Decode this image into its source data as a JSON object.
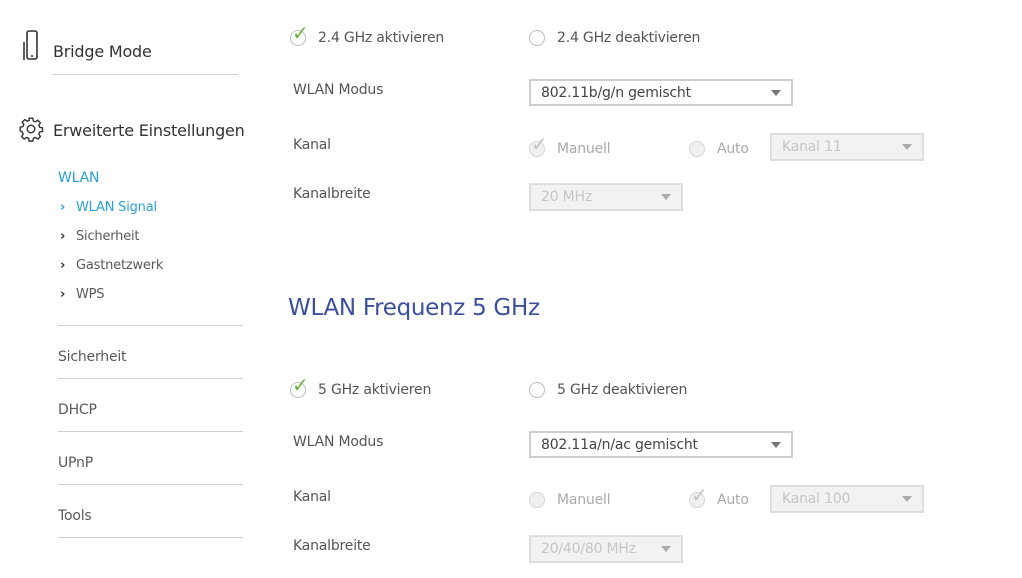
{
  "sidebar": {
    "bridge_mode": "Bridge Mode",
    "advanced": "Erweiterte Einstellungen",
    "wlan_heading": "WLAN",
    "wlan_items": [
      {
        "label": "WLAN Signal"
      },
      {
        "label": "Sicherheit"
      },
      {
        "label": "Gastnetzwerk"
      },
      {
        "label": "WPS"
      }
    ],
    "sections": [
      {
        "label": "Sicherheit"
      },
      {
        "label": "DHCP"
      },
      {
        "label": "UPnP"
      },
      {
        "label": "Tools"
      }
    ]
  },
  "band24": {
    "enable": "2.4 GHz aktivieren",
    "disable": "2.4 GHz deaktivieren",
    "mode_label": "WLAN Modus",
    "mode_value": "802.11b/g/n gemischt",
    "channel_label": "Kanal",
    "manual": "Manuell",
    "auto": "Auto",
    "channel_value": "Kanal 11",
    "width_label": "Kanalbreite",
    "width_value": "20 MHz"
  },
  "band5": {
    "title": "WLAN Frequenz 5 GHz",
    "enable": "5 GHz aktivieren",
    "disable": "5 GHz deaktivieren",
    "mode_label": "WLAN Modus",
    "mode_value": "802.11a/n/ac gemischt",
    "channel_label": "Kanal",
    "manual": "Manuell",
    "auto": "Auto",
    "channel_value": "Kanal 100",
    "width_label": "Kanalbreite",
    "width_value": "20/40/80 MHz"
  },
  "colors": {
    "accent": "#2aa0d8",
    "title": "#3b4f9e",
    "check": "#6ab23e"
  }
}
